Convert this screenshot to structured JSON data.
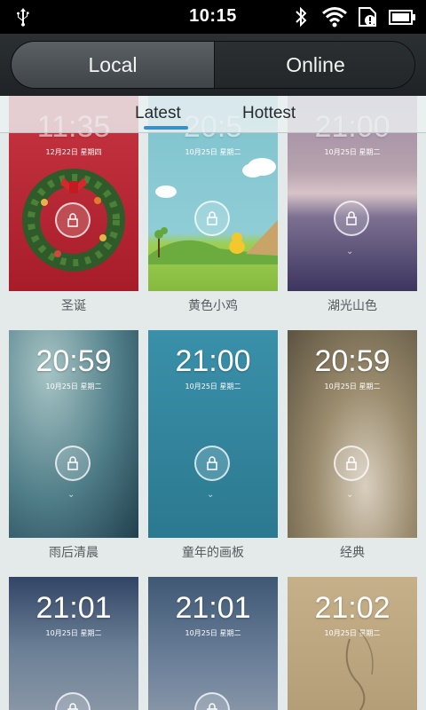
{
  "status_bar": {
    "time": "10:15",
    "icons": [
      "usb-icon",
      "bluetooth-icon",
      "wifi-icon",
      "sim-alert-icon",
      "battery-icon"
    ]
  },
  "tabs": {
    "local": "Local",
    "online": "Online",
    "active": "local"
  },
  "subtabs": {
    "latest": "Latest",
    "hottest": "Hottest",
    "active": "latest"
  },
  "accent_color": "#3a8fc9",
  "themes": [
    {
      "time": "11:35",
      "date": "12月22日  星期四",
      "name": "圣诞"
    },
    {
      "time": "20:5",
      "date": "10月25日  星期二",
      "name": "黄色小鸡"
    },
    {
      "time": "21:00",
      "date": "10月25日  星期二",
      "name": "湖光山色"
    },
    {
      "time": "20:59",
      "date": "10月25日  星期二",
      "name": "雨后清晨"
    },
    {
      "time": "21:00",
      "date": "10月25日  星期二",
      "name": "童年的画板"
    },
    {
      "time": "20:59",
      "date": "10月25日  星期二",
      "name": "经典"
    },
    {
      "time": "21:01",
      "date": "10月25日  星期二",
      "name": ""
    },
    {
      "time": "21:01",
      "date": "10月25日  星期二",
      "name": ""
    },
    {
      "time": "21:02",
      "date": "10月25日  星期二",
      "name": ""
    }
  ]
}
